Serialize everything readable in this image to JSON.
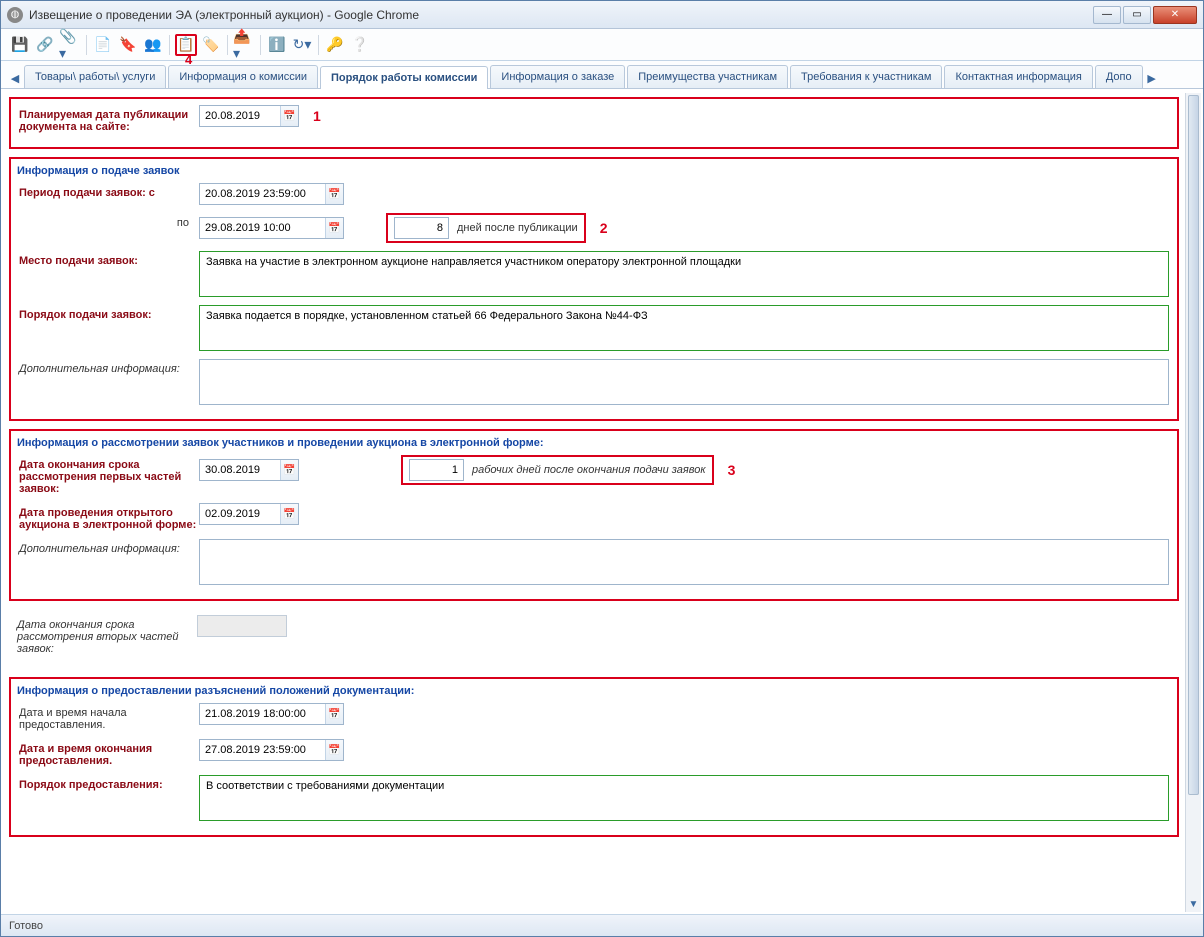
{
  "window": {
    "title": "Извещение о проведении ЭА (электронный аукцион) - Google Chrome"
  },
  "winbtns": {
    "min": "—",
    "max": "▭",
    "close": "✕"
  },
  "tabs": {
    "left_arrow": "◀",
    "right_arrow": "▶",
    "items": [
      "Товары\\ работы\\ услуги",
      "Информация о комиссии",
      "Порядок работы комиссии",
      "Информация о заказе",
      "Преимущества участникам",
      "Требования к участникам",
      "Контактная информация",
      "Допо"
    ],
    "active_index": 2
  },
  "annot": {
    "a1": "1",
    "a2": "2",
    "a3": "3",
    "a4": "4"
  },
  "sec1": {
    "pub_date_label": "Планируемая дата публикации документа на сайте:",
    "pub_date": "20.08.2019"
  },
  "sec2": {
    "title": "Информация о подаче заявок",
    "period_from_label": "Период подачи заявок: с",
    "period_from": "20.08.2019 23:59:00",
    "period_to_label": "по",
    "period_to": "29.08.2019 10:00",
    "days_value": "8",
    "days_after": "дней после публикации",
    "place_label": "Место подачи заявок:",
    "place_value": "Заявка на участие в электронном аукционе направляется участником оператору электронной площадки",
    "order_label": "Порядок подачи заявок:",
    "order_value": "Заявка подается в порядке, установленном статьей 66 Федерального Закона №44-ФЗ",
    "extra_label": "Дополнительная информация:",
    "extra_value": ""
  },
  "sec3": {
    "title": "Информация о рассмотрении заявок участников и проведении аукциона в электронной форме:",
    "end_first_label": "Дата окончания срока рассмотрения первых частей заявок:",
    "end_first": "30.08.2019",
    "workdays_value": "1",
    "workdays_after": "рабочих дней после окончания подачи заявок",
    "open_auc_label": "Дата проведения открытого аукциона в электронной форме:",
    "open_auc": "02.09.2019",
    "extra_label": "Дополнительная информация:",
    "extra_value": ""
  },
  "sec4": {
    "end_second_label": "Дата окончания срока рассмотрения вторых частей заявок:"
  },
  "sec5": {
    "title": "Информация о предоставлении разъяснений положений документации:",
    "start_label": "Дата и время начала предоставления.",
    "start": "21.08.2019 18:00:00",
    "end_label": "Дата и время окончания предоставления.",
    "end": "27.08.2019 23:59:00",
    "order_label": "Порядок предоставления:",
    "order_value": "В соответствии с требованиями документации"
  },
  "status": "Готово",
  "icons": {
    "cal": "📅",
    "globe": "◍"
  }
}
